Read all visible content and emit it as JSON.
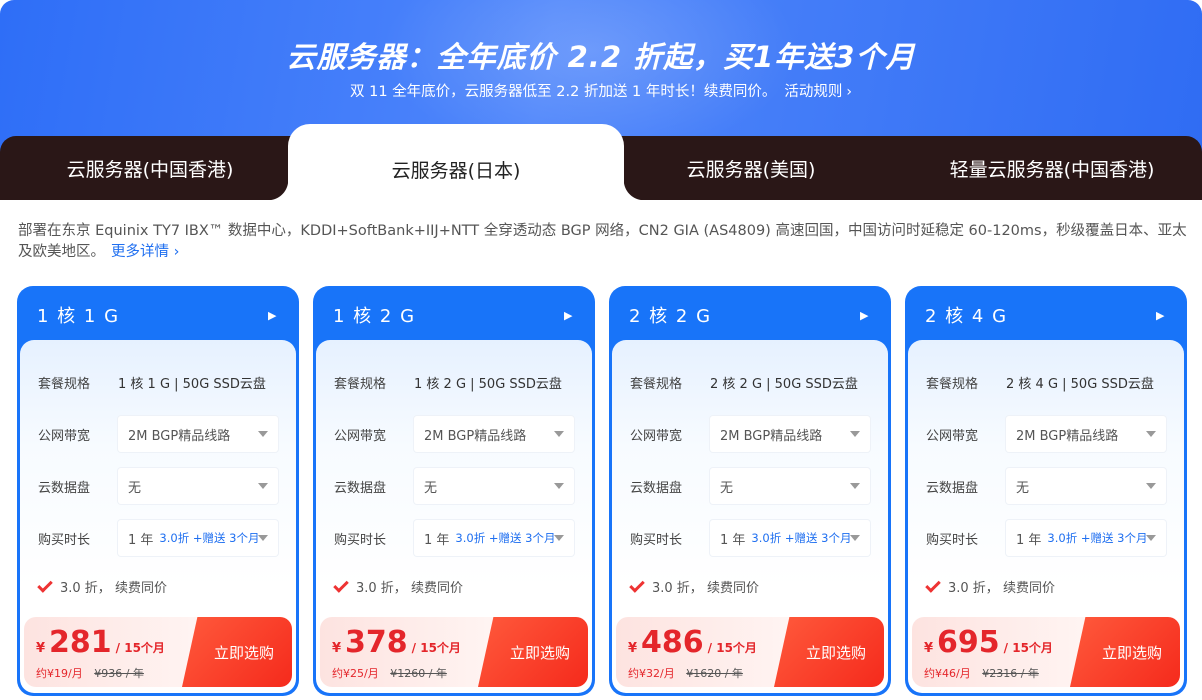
{
  "hero": {
    "title": "云服务器：全年底价 2.2 折起，买1年送3个月",
    "subtitle": "双 11 全年底价，云服务器低至 2.2 折加送 1 年时长！续费同价。",
    "rules_link": "活动规则",
    "colors": {
      "bg_start": "#2e6ef7",
      "bg_end": "#2f6cf3"
    }
  },
  "tabs": [
    {
      "label": "云服务器(中国香港)",
      "active": false
    },
    {
      "label": "云服务器(日本)",
      "active": true
    },
    {
      "label": "云服务器(美国)",
      "active": false
    },
    {
      "label": "轻量云服务器(中国香港)",
      "active": false
    }
  ],
  "description": {
    "text": "部署在东京 Equinix TY7 IBX™ 数据中心，KDDI+SoftBank+IIJ+NTT 全穿透动态 BGP 网络，CN2 GIA (AS4809) 高速回国，中国访问时延稳定 60-120ms，秒级覆盖日本、亚太及欧美地区。",
    "more_link": "更多详情"
  },
  "labels": {
    "spec": "套餐规格",
    "bandwidth": "公网带宽",
    "disk": "云数据盘",
    "duration": "购买时长",
    "buy": "立即选购"
  },
  "cards": [
    {
      "title": "1 核 1 G",
      "spec_value": "1 核 1 G | 50G SSD云盘",
      "bandwidth": "2M BGP精品线路",
      "disk": "无",
      "duration": "1 年",
      "duration_promo": "3.0折 +赠送 3个月",
      "check_text": "3.0 折， 续费同价",
      "currency": "¥",
      "price": "281",
      "per": "/ 15个月",
      "monthly": "约¥19/月",
      "original": "¥936 / 年"
    },
    {
      "title": "1 核 2 G",
      "spec_value": "1 核 2 G | 50G SSD云盘",
      "bandwidth": "2M BGP精品线路",
      "disk": "无",
      "duration": "1 年",
      "duration_promo": "3.0折 +赠送 3个月",
      "check_text": "3.0 折， 续费同价",
      "currency": "¥",
      "price": "378",
      "per": "/ 15个月",
      "monthly": "约¥25/月",
      "original": "¥1260 / 年"
    },
    {
      "title": "2 核 2 G",
      "spec_value": "2 核 2 G | 50G SSD云盘",
      "bandwidth": "2M BGP精品线路",
      "disk": "无",
      "duration": "1 年",
      "duration_promo": "3.0折 +赠送 3个月",
      "check_text": "3.0 折， 续费同价",
      "currency": "¥",
      "price": "486",
      "per": "/ 15个月",
      "monthly": "约¥32/月",
      "original": "¥1620 / 年"
    },
    {
      "title": "2 核 4 G",
      "spec_value": "2 核 4 G | 50G SSD云盘",
      "bandwidth": "2M BGP精品线路",
      "disk": "无",
      "duration": "1 年",
      "duration_promo": "3.0折 +赠送 3个月",
      "check_text": "3.0 折， 续费同价",
      "currency": "¥",
      "price": "695",
      "per": "/ 15个月",
      "monthly": "约¥46/月",
      "original": "¥2316 / 年"
    }
  ]
}
